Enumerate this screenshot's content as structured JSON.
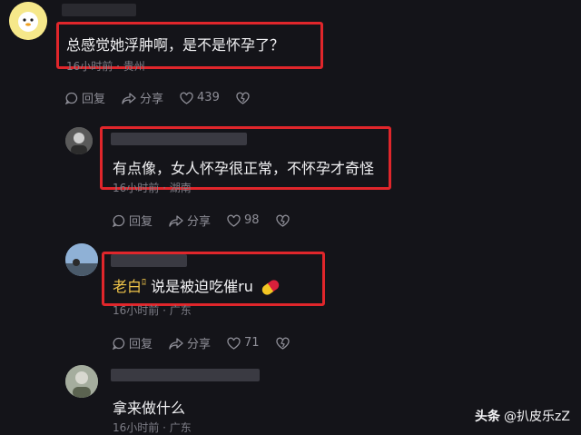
{
  "comments": [
    {
      "text": "总感觉她浮肿啊，是不是怀孕了？",
      "meta": "16小时前 · 贵州",
      "reply_label": "回复",
      "share_label": "分享",
      "like_count": "439"
    },
    {
      "text": "有点像，女人怀孕很正常，不怀孕才奇怪",
      "meta": "16小时前 · 湖南",
      "reply_label": "回复",
      "share_label": "分享",
      "like_count": "98"
    },
    {
      "nickname": "老白",
      "text": "说是被迫吃催ru",
      "meta": "16小时前 · 广东",
      "reply_label": "回复",
      "share_label": "分享",
      "like_count": "71"
    },
    {
      "text": "拿来做什么",
      "meta": "16小时前 · 广东"
    }
  ],
  "watermark": {
    "brand": "头条",
    "handle": "@扒皮乐zZ"
  },
  "colors": {
    "highlight_box": "#e0262b",
    "background": "#141419",
    "nickname": "#f0c54a"
  }
}
